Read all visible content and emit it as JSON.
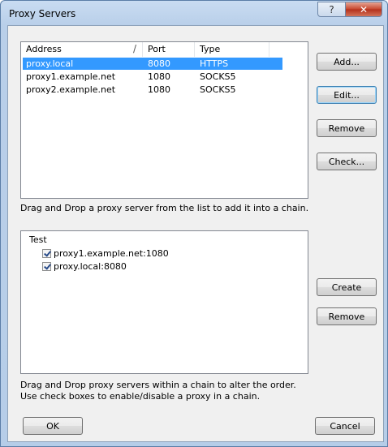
{
  "window": {
    "title": "Proxy Servers",
    "help_glyph": "?",
    "close_glyph": "✕"
  },
  "proxy_list": {
    "columns": [
      "Address",
      "Port",
      "Type"
    ],
    "sort_indicator": "/",
    "rows": [
      {
        "address": "proxy.local",
        "port": "8080",
        "type": "HTTPS",
        "selected": true
      },
      {
        "address": "proxy1.example.net",
        "port": "1080",
        "type": "SOCKS5",
        "selected": false
      },
      {
        "address": "proxy2.example.net",
        "port": "1080",
        "type": "SOCKS5",
        "selected": false
      }
    ]
  },
  "list_buttons": {
    "add": "Add...",
    "edit": "Edit...",
    "remove": "Remove",
    "check": "Check..."
  },
  "hint_top": "Drag and Drop a proxy server from the list to add it into a chain.",
  "chain": {
    "name": "Test",
    "items": [
      {
        "label": "proxy1.example.net:1080",
        "checked": true
      },
      {
        "label": "proxy.local:8080",
        "checked": true
      }
    ]
  },
  "chain_buttons": {
    "create": "Create",
    "remove": "Remove"
  },
  "hint_bottom_1": "Drag and Drop proxy servers within a chain to alter the order.",
  "hint_bottom_2": "Use check boxes to enable/disable a proxy in a chain.",
  "footer": {
    "ok": "OK",
    "cancel": "Cancel"
  }
}
